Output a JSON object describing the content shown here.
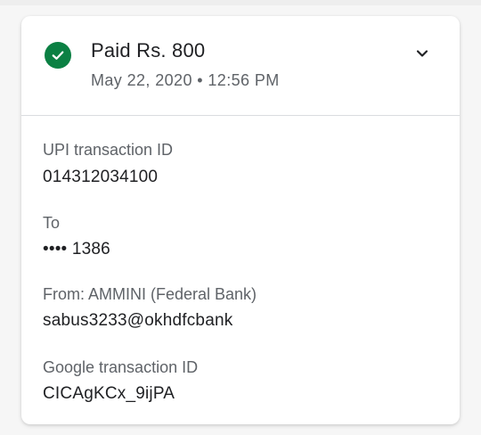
{
  "payment": {
    "title": "Paid Rs. 800",
    "datetime": "May 22, 2020 • 12:56 PM",
    "status_icon": "check-circle-icon",
    "expand_icon": "chevron-down-icon",
    "accent_color": "#0b8043"
  },
  "details": {
    "upi_label": "UPI transaction ID",
    "upi_value": "014312034100",
    "to_label": "To",
    "to_value": "•••• 1386",
    "from_label": "From: AMMINI (Federal Bank)",
    "from_value": "sabus3233@okhdfcbank",
    "google_label": "Google transaction ID",
    "google_value": "CICAgKCx_9ijPA"
  }
}
